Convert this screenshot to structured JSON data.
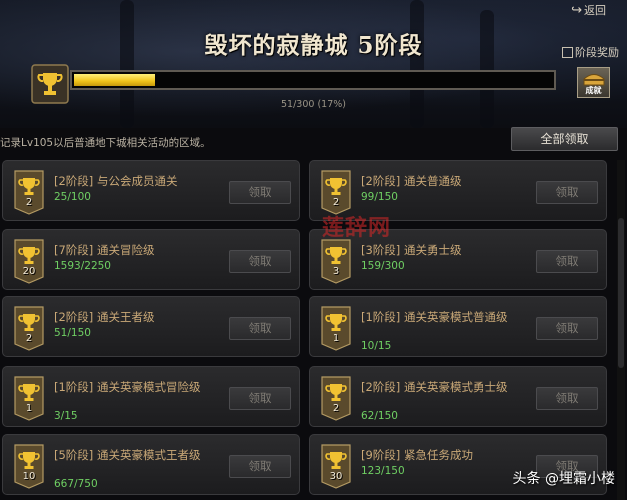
{
  "header": {
    "back_label": "返回",
    "title": "毁坏的寂静城 5阶段",
    "reward_label": "阶段奖励",
    "chest_label": "成就",
    "progress_text": "51/300 (17%)",
    "progress_value": 51,
    "progress_max": 300,
    "progress_fraction": 0.17
  },
  "description": "记录Lv105以后普通地下城相关活动的区域。",
  "claim_all_label": "全部领取",
  "cards": [
    {
      "badge": "2",
      "name": "[2阶段] 与公会成员通关",
      "count": "25/100",
      "button": "领取"
    },
    {
      "badge": "2",
      "name": "[2阶段] 通关普通级",
      "count": "99/150",
      "button": "领取"
    },
    {
      "badge": "20",
      "name": "[7阶段] 通关冒险级",
      "count": "1593/2250",
      "button": "领取"
    },
    {
      "badge": "3",
      "name": "[3阶段] 通关勇士级",
      "count": "159/300",
      "button": "领取"
    },
    {
      "badge": "2",
      "name": "[2阶段] 通关王者级",
      "count": "51/150",
      "button": "领取"
    },
    {
      "badge": "1",
      "name": "[1阶段] 通关英豪模式普通级",
      "count": "10/15",
      "button": "领取"
    },
    {
      "badge": "1",
      "name": "[1阶段] 通关英豪模式冒险级",
      "count": "3/15",
      "button": "领取"
    },
    {
      "badge": "2",
      "name": "[2阶段] 通关英豪模式勇士级",
      "count": "62/150",
      "button": "领取"
    },
    {
      "badge": "10",
      "name": "[5阶段] 通关英豪模式王者级",
      "count": "667/750",
      "button": "领取"
    },
    {
      "badge": "30",
      "name": "[9阶段] 紧急任务成功",
      "count": "123/150",
      "button": "领取"
    }
  ],
  "overlays": {
    "watermark": "莲辞网",
    "credit": "头条 @埋霜小楼"
  },
  "colors": {
    "progress_fill": "#f0c31a",
    "card_name": "#c9a877",
    "card_count": "#6fcf63",
    "watermark": "#d72828"
  },
  "icons": [
    "back-icon",
    "reward-icon",
    "trophy-icon",
    "chest-icon"
  ]
}
